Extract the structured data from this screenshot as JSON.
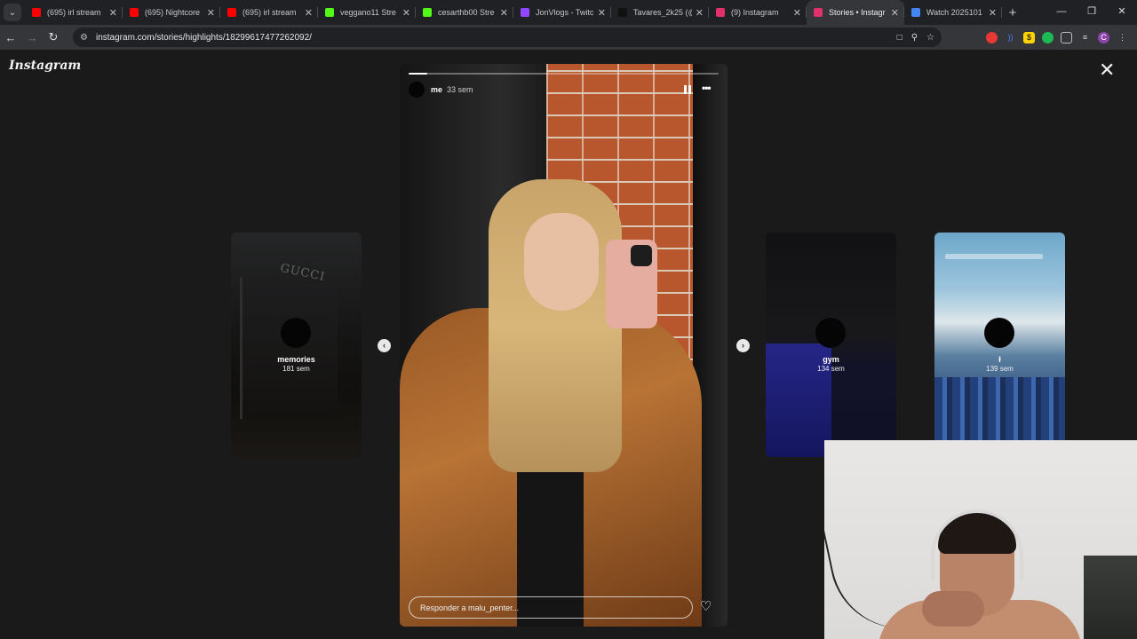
{
  "browser": {
    "tabs": [
      {
        "title": "(695) irl stream",
        "favicon_color": "#ff0000",
        "active": false
      },
      {
        "title": "(695) Nightcore",
        "favicon_color": "#ff0000",
        "active": false
      },
      {
        "title": "(695) irl stream",
        "favicon_color": "#ff0000",
        "active": false
      },
      {
        "title": "veggano11 Stre",
        "favicon_color": "#53fc18",
        "active": false
      },
      {
        "title": "cesarthb00 Stre",
        "favicon_color": "#53fc18",
        "active": false
      },
      {
        "title": "JonVlogs - Twitc",
        "favicon_color": "#9146ff",
        "active": false
      },
      {
        "title": "Tavares_2k25 (@",
        "favicon_color": "#111111",
        "active": false
      },
      {
        "title": "(9) Instagram",
        "favicon_color": "#e1306c",
        "active": false
      },
      {
        "title": "Stories • Instagr",
        "favicon_color": "#e1306c",
        "active": true
      },
      {
        "title": "Watch 2025101",
        "favicon_color": "#4285f4",
        "active": false
      }
    ],
    "url": "instagram.com/stories/highlights/18299617477262092/"
  },
  "page": {
    "logo": "Instagram"
  },
  "highlights": {
    "left": {
      "name": "memories",
      "time": "181 sem"
    },
    "right1": {
      "name": "gym",
      "time": "134 sem"
    },
    "right2": {
      "name": "ł",
      "time": "139 sem"
    }
  },
  "story": {
    "username": "me",
    "time_ago": "33 sem",
    "reply_placeholder": "Responder a malu_penter...",
    "progress": 0.06
  },
  "colors": {
    "accent": "#e1306c",
    "chrome_dark": "#202124",
    "page_bg": "#1a1a1a"
  }
}
